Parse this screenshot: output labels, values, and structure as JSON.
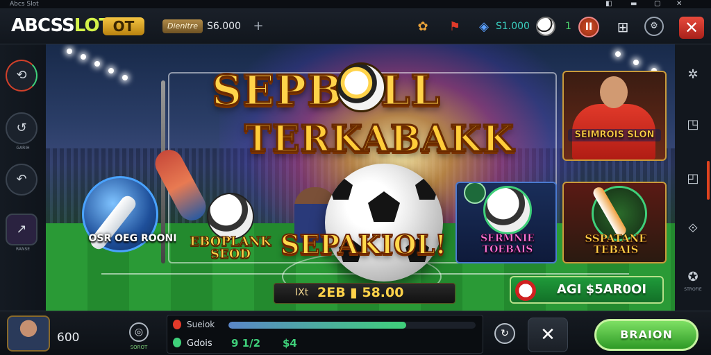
{
  "window": {
    "title": "Abcs Slot"
  },
  "topbar": {
    "logo_main": "ABCSS",
    "logo_accent": "LOT",
    "logo_badge": "OT",
    "balance_chip": "Dienitre",
    "balance_value": "S6.000",
    "plus_label": "+",
    "coins_value": "S1.000",
    "level_value": "1",
    "pause_label": "II"
  },
  "left_sidebar": {
    "items": [
      {
        "icon": "spin-icon",
        "glyph": "⟲",
        "label": ""
      },
      {
        "icon": "refresh-icon",
        "glyph": "↺",
        "label": "GARIH"
      },
      {
        "icon": "undo-icon",
        "glyph": "↶",
        "label": ""
      },
      {
        "icon": "chart-icon",
        "glyph": "↗",
        "label": "RANSE"
      }
    ]
  },
  "right_sidebar": {
    "bottom_label": "STROFIE"
  },
  "game": {
    "title_line1": "SEPBOLL",
    "title_line2": "TERKABAKK",
    "subtitle": "SEPAKIOL!",
    "card_left_label": "OSR OEG ROONI",
    "card_leg_label": "EBOPLANK SEOD",
    "card_r1_label": "SEIMROIS SLON",
    "card_r2_label": "SERMNIE TOEBAIS",
    "card_r3_label": "SSPATANE TEBAIS",
    "bet_prefix": "IXt",
    "bet_value": "2EB ▮ 58.00",
    "win_label": "AGI $5AR0OI"
  },
  "bottom": {
    "player_value": "600",
    "swirl_label": "SOROT",
    "status_line1": "Sueiok",
    "progress": 0.72,
    "status_line2": "Gdois",
    "status_val2": "9 1/2",
    "status_val3": "$4",
    "go_label": "BRAION"
  },
  "colors": {
    "accent_green": "#3fd07a",
    "close_red": "#d8332a",
    "title_gold": "#ffd34a"
  }
}
